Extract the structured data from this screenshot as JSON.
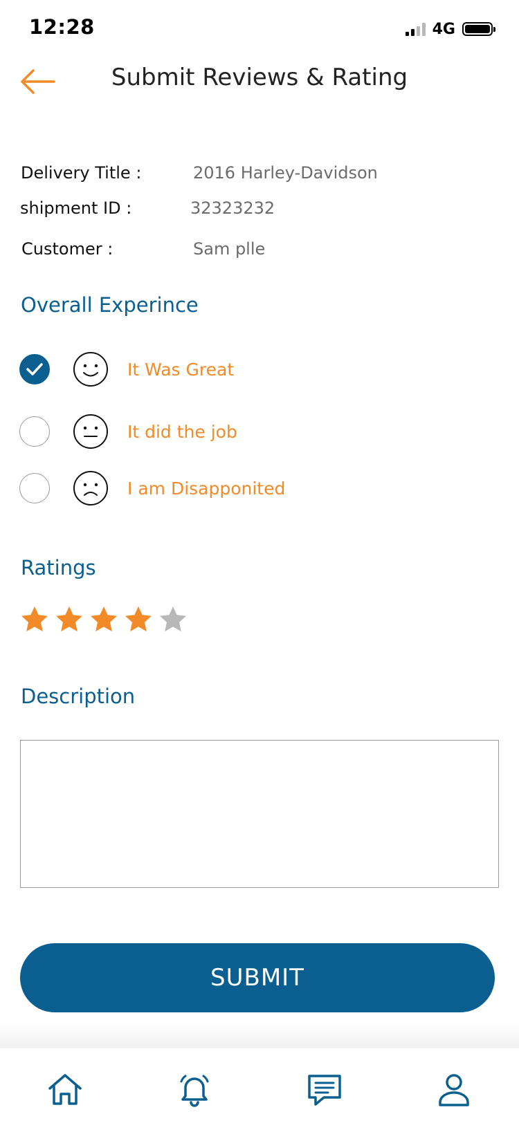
{
  "status_bar": {
    "time": "12:28",
    "network": "4G"
  },
  "header": {
    "title": "Submit Reviews & Rating",
    "back_icon": "arrow-left-icon"
  },
  "details": [
    {
      "label": "Delivery Title :",
      "value": "2016 Harley-Davidson"
    },
    {
      "label": "shipment ID :",
      "value": "32323232"
    },
    {
      "label": "Customer :",
      "value": "Sam plle"
    }
  ],
  "experience": {
    "title": "Overall Experince",
    "options": [
      {
        "label": "It Was Great",
        "icon": "smile-face-icon",
        "selected": true
      },
      {
        "label": "It did the job",
        "icon": "neutral-face-icon",
        "selected": false
      },
      {
        "label": "I am Disapponited",
        "icon": "sad-face-icon",
        "selected": false
      }
    ]
  },
  "ratings": {
    "title": "Ratings",
    "value": 4,
    "max": 5
  },
  "description": {
    "title": "Description",
    "value": "",
    "placeholder": ""
  },
  "submit": {
    "label": "SUBMIT"
  },
  "bottom_nav": [
    {
      "icon": "home-icon"
    },
    {
      "icon": "bell-icon"
    },
    {
      "icon": "chat-icon"
    },
    {
      "icon": "user-icon"
    }
  ],
  "colors": {
    "primary": "#0b5f90",
    "accent": "#f28a28",
    "star_active": "#f28a28",
    "star_inactive": "#b8b8b8"
  }
}
